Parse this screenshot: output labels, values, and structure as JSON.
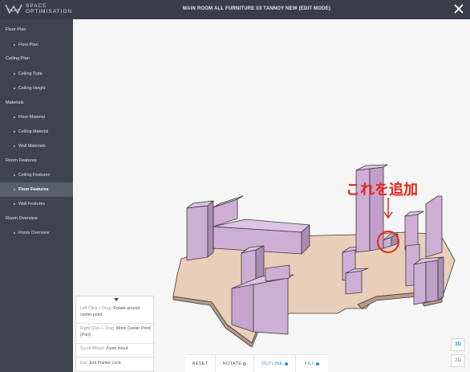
{
  "app": {
    "logo_line1": "SPACE",
    "logo_line2": "OPTIMISATION",
    "title": "MAIN ROOM ALL FURNITURE 03 TANNOY NEW (EDIT MODE)"
  },
  "sidebar": {
    "sections": [
      {
        "label": "Floor Plan",
        "items": [
          "Floor Plan"
        ]
      },
      {
        "label": "Ceiling Plan",
        "items": [
          "Ceiling Type",
          "Ceiling Height"
        ]
      },
      {
        "label": "Materials",
        "items": [
          "Floor Material",
          "Ceiling Material",
          "Wall Materials"
        ]
      },
      {
        "label": "Room Features",
        "items": [
          "Ceiling Features",
          "Floor Features",
          "Wall Features"
        ]
      },
      {
        "label": "Room Overview",
        "items": [
          "Room Overview"
        ]
      }
    ],
    "active_item": "Floor Features"
  },
  "annotation": {
    "text": "これを追加",
    "color": "#e8261d"
  },
  "controls": [
    {
      "key": "Left Click + Drag:",
      "action": "Rotate around center point"
    },
    {
      "key": "Right Click + Drag:",
      "action": "Move Center Point (Pan)"
    },
    {
      "key": "Scroll Wheel:",
      "action": "Zoom in/out"
    },
    {
      "key": "Esc:",
      "action": "Exit Pointer Lock"
    }
  ],
  "toolbar": {
    "reset": "RESET",
    "rotate": "ROTATE",
    "outline": "OUTLINE",
    "fill": "FILL"
  },
  "view_toggle": {
    "three_d": "3D",
    "two_d": "2D",
    "selected": "3D"
  },
  "colors": {
    "topbar": "#3a3d49",
    "sidebar": "#40434f",
    "floor": "#e8cdb9",
    "furniture": "#d2b3d6",
    "accent": "#2b8fd6",
    "annotation": "#e8261d"
  }
}
